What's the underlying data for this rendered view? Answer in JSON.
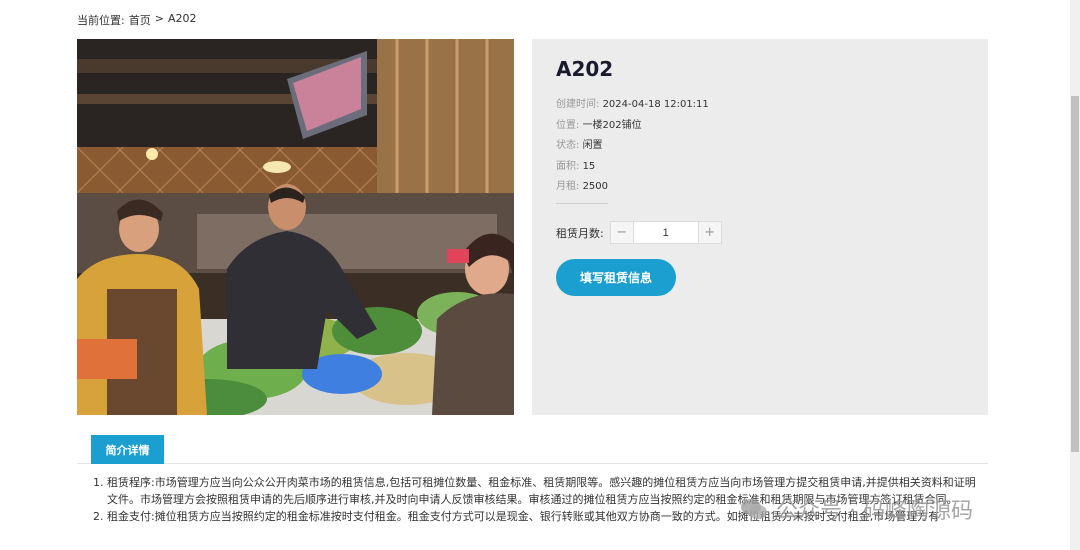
{
  "breadcrumb": {
    "prefix": "当前位置:",
    "home": "首页",
    "separator": ">",
    "current": "A202"
  },
  "product": {
    "title": "A202",
    "fields": [
      {
        "label": "创建时间:",
        "value": "2024-04-18 12:01:11"
      },
      {
        "label": "位置:",
        "value": "一楼202铺位"
      },
      {
        "label": "状态:",
        "value": "闲置"
      },
      {
        "label": "面积:",
        "value": "15"
      },
      {
        "label": "月租:",
        "value": "2500"
      }
    ],
    "quantity_label": "租赁月数:",
    "quantity_value": "1",
    "minus_symbol": "−",
    "plus_symbol": "+",
    "cta_label": "填写租赁信息"
  },
  "tabs": {
    "active_label": "简介详情"
  },
  "description": [
    "租赁程序:市场管理方应当向公众公开肉菜市场的租赁信息,包括可租摊位数量、租金标准、租赁期限等。感兴趣的摊位租赁方应当向市场管理方提交租赁申请,并提供相关资料和证明文件。市场管理方会按照租赁申请的先后顺序进行审核,并及时向申请人反馈审核结果。审核通过的摊位租赁方应当按照约定的租金标准和租赁期限与市场管理方签订租赁合同。",
    "租金支付:摊位租赁方应当按照约定的租金标准按时支付租金。租金支付方式可以是现金、银行转账或其他双方协商一致的方式。如摊位租赁方未按时支付租金,市场管理方有"
  ],
  "watermark": {
    "text": "公众号 · 码峰陶源码"
  },
  "colors": {
    "accent": "#1a9fd0",
    "panel_bg": "#ececec"
  }
}
